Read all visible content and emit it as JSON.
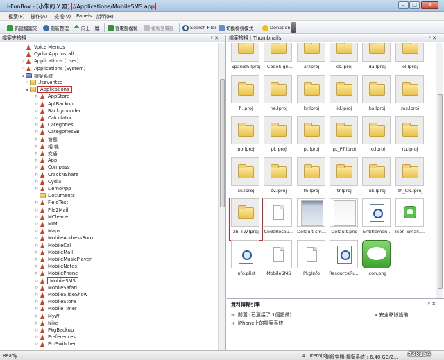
{
  "window": {
    "title_prefix": "i-FunBox - [小朱的 Y 窩]",
    "title_path": "//Applications/MobileSMS.app",
    "min_icon": "minimize-icon",
    "max_icon": "maximize-icon",
    "close_icon": "close-icon"
  },
  "menu": [
    "檔案(F)",
    "操作(A)",
    "檢視(V)",
    "Panels",
    "說明(H)"
  ],
  "toolbar": {
    "new_folder": "新建檔案夾",
    "refresh": "重新整理",
    "up": "向上一層",
    "copy_to_pc": "從電腦複製",
    "copy_to_device": "複製至電腦",
    "search": "Search Files",
    "view_mode": "切換檢視模式",
    "donation": "Donation"
  },
  "left_panel": {
    "title": "檔案夾檢視",
    "pin": "ᵖ ✕",
    "tree": [
      {
        "label": "Voice Memos",
        "icon": "app-icon",
        "level": 2,
        "toggle": ""
      },
      {
        "label": "Cydia App Install",
        "icon": "app-icon",
        "level": 2,
        "toggle": ""
      },
      {
        "label": "Applications (User)",
        "icon": "app-icon",
        "level": 2,
        "toggle": "▷"
      },
      {
        "label": "Applications (System)",
        "icon": "app-icon",
        "level": 2,
        "toggle": "▷"
      },
      {
        "label": "檔案系統",
        "icon": "device-icon",
        "level": 2,
        "toggle": "◢"
      },
      {
        "label": ".fseventsd",
        "icon": "folder-icon",
        "level": 3,
        "toggle": "▷"
      },
      {
        "label": "Applications",
        "icon": "folder-icon",
        "level": 3,
        "toggle": "◢",
        "highlight": true
      },
      {
        "label": "AppStore",
        "icon": "app-icon",
        "level": 4,
        "toggle": "▷"
      },
      {
        "label": "AptBackup",
        "icon": "app-icon",
        "level": 4,
        "toggle": "▷"
      },
      {
        "label": "Backgrounder",
        "icon": "app-icon",
        "level": 4,
        "toggle": "▷"
      },
      {
        "label": "Calculator",
        "icon": "app-icon",
        "level": 4,
        "toggle": "▷"
      },
      {
        "label": "Categories",
        "icon": "app-icon",
        "level": 4,
        "toggle": "▷"
      },
      {
        "label": "CategoriesSB",
        "icon": "app-icon",
        "level": 4,
        "toggle": "▷"
      },
      {
        "label": "遊戲",
        "icon": "app-icon",
        "level": 4,
        "toggle": "▷"
      },
      {
        "label": "相 機",
        "icon": "app-icon",
        "level": 4,
        "toggle": "▷"
      },
      {
        "label": "交通",
        "icon": "app-icon",
        "level": 4,
        "toggle": "▷"
      },
      {
        "label": "App",
        "icon": "app-icon",
        "level": 4,
        "toggle": "▷"
      },
      {
        "label": "Compass",
        "icon": "app-icon",
        "level": 4,
        "toggle": "▷"
      },
      {
        "label": "CrackNShare",
        "icon": "app-icon",
        "level": 4,
        "toggle": "▷"
      },
      {
        "label": "Cydia",
        "icon": "app-icon",
        "level": 4,
        "toggle": "▷"
      },
      {
        "label": "DemoApp",
        "icon": "app-icon",
        "level": 4,
        "toggle": "▷"
      },
      {
        "label": "Documents",
        "icon": "folder-icon",
        "level": 4,
        "toggle": ""
      },
      {
        "label": "FieldTest",
        "icon": "app-icon",
        "level": 4,
        "toggle": "▷"
      },
      {
        "label": "File2Mail",
        "icon": "app-icon",
        "level": 4,
        "toggle": "▷"
      },
      {
        "label": "MCleaner",
        "icon": "app-icon",
        "level": 4,
        "toggle": "▷"
      },
      {
        "label": "MIM",
        "icon": "app-icon",
        "level": 4,
        "toggle": "▷"
      },
      {
        "label": "Maps",
        "icon": "app-icon",
        "level": 4,
        "toggle": "▷"
      },
      {
        "label": "MobileAddressBook",
        "icon": "app-icon",
        "level": 4,
        "toggle": "▷"
      },
      {
        "label": "MobileCal",
        "icon": "app-icon",
        "level": 4,
        "toggle": "▷"
      },
      {
        "label": "MobileMail",
        "icon": "app-icon",
        "level": 4,
        "toggle": "▷"
      },
      {
        "label": "MobileMusicPlayer",
        "icon": "app-icon",
        "level": 4,
        "toggle": "▷"
      },
      {
        "label": "MobileNotes",
        "icon": "app-icon",
        "level": 4,
        "toggle": "▷"
      },
      {
        "label": "MobilePhone",
        "icon": "app-icon",
        "level": 4,
        "toggle": "▷"
      },
      {
        "label": "MobileSMS",
        "icon": "app-icon",
        "level": 4,
        "toggle": "▷",
        "highlight": true
      },
      {
        "label": "MobileSafari",
        "icon": "app-icon",
        "level": 4,
        "toggle": "▷"
      },
      {
        "label": "MobileSlideShow",
        "icon": "app-icon",
        "level": 4,
        "toggle": "▷"
      },
      {
        "label": "MobileStore",
        "icon": "app-icon",
        "level": 4,
        "toggle": "▷"
      },
      {
        "label": "MobileTimer",
        "icon": "app-icon",
        "level": 4,
        "toggle": "▷"
      },
      {
        "label": "MyWi",
        "icon": "app-icon",
        "level": 4,
        "toggle": "▷"
      },
      {
        "label": "Nike",
        "icon": "app-icon",
        "level": 4,
        "toggle": "▷"
      },
      {
        "label": "PkgBackup",
        "icon": "app-icon",
        "level": 4,
        "toggle": "▷"
      },
      {
        "label": "Preferences",
        "icon": "app-icon",
        "level": 4,
        "toggle": "▷"
      },
      {
        "label": "ProSwitcher",
        "icon": "app-icon",
        "level": 4,
        "toggle": "▷"
      }
    ]
  },
  "right_panel": {
    "title": "檔案檢視",
    "tab": "Thumbnails",
    "pin": "ᵖ ✕",
    "files": [
      {
        "name": "Spanish.lproj",
        "kind": "folder"
      },
      {
        "name": "_CodeSign...",
        "kind": "folder"
      },
      {
        "name": "ar.lproj",
        "kind": "folder"
      },
      {
        "name": "cs.lproj",
        "kind": "folder"
      },
      {
        "name": "da.lproj",
        "kind": "folder"
      },
      {
        "name": "el.lproj",
        "kind": "folder"
      },
      {
        "name": "fi.lproj",
        "kind": "folder"
      },
      {
        "name": "he.lproj",
        "kind": "folder"
      },
      {
        "name": "hr.lproj",
        "kind": "folder"
      },
      {
        "name": "id.lproj",
        "kind": "folder"
      },
      {
        "name": "ko.lproj",
        "kind": "folder"
      },
      {
        "name": "ms.lproj",
        "kind": "folder"
      },
      {
        "name": "no.lproj",
        "kind": "folder"
      },
      {
        "name": "pl.lproj",
        "kind": "folder"
      },
      {
        "name": "pt.lproj",
        "kind": "folder"
      },
      {
        "name": "pt_PT.lproj",
        "kind": "folder"
      },
      {
        "name": "ro.lproj",
        "kind": "folder"
      },
      {
        "name": "ru.lproj",
        "kind": "folder"
      },
      {
        "name": "sk.lproj",
        "kind": "folder"
      },
      {
        "name": "sv.lproj",
        "kind": "folder"
      },
      {
        "name": "th.lproj",
        "kind": "folder"
      },
      {
        "name": "tr.lproj",
        "kind": "folder"
      },
      {
        "name": "uk.lproj",
        "kind": "folder"
      },
      {
        "name": "zh_CN.lproj",
        "kind": "folder"
      },
      {
        "name": "zh_TW.lproj",
        "kind": "folder",
        "highlight": true
      },
      {
        "name": "CodeResou...",
        "kind": "doc"
      },
      {
        "name": "Default-sm...",
        "kind": "png-grey"
      },
      {
        "name": "Default.png",
        "kind": "png"
      },
      {
        "name": "Entitlemen...",
        "kind": "plist"
      },
      {
        "name": "Icon-Small....",
        "kind": "sms-small"
      },
      {
        "name": "Info.plist",
        "kind": "plist"
      },
      {
        "name": "MobileSMS",
        "kind": "doc"
      },
      {
        "name": "PkgInfo",
        "kind": "doc"
      },
      {
        "name": "ResourceRu...",
        "kind": "plist"
      },
      {
        "name": "icon.png",
        "kind": "sms-big"
      }
    ]
  },
  "transfer_panel": {
    "title": "資料傳輸引擎",
    "pin": "ᵖ ✕",
    "row1_label": "閒置 (已連接了 1個設備)",
    "row1_action": "安全移除設備",
    "row2_label": "iPhone上的檔案系統"
  },
  "status": {
    "left": "Ready",
    "items": "41 Item(s)",
    "space": "剩餘空間(檔案系統): 6.40 GB/2..."
  },
  "watermark": "#38154",
  "colors": {
    "highlight": "#d02828",
    "accent": "#3b6aa8"
  }
}
